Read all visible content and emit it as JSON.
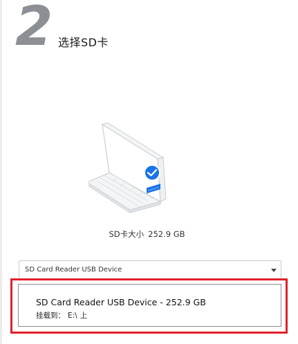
{
  "step": {
    "number": "2",
    "title": "选择SD卡"
  },
  "illustration": {
    "icon": "laptop-with-sd-card-icon",
    "accent_color": "#1a73e8"
  },
  "card_info": {
    "label": "SD卡大小",
    "value": "252.9 GB"
  },
  "device_select": {
    "selected_value": "SD Card Reader USB Device"
  },
  "device_option": {
    "name": "SD Card Reader USB Device - 252.9 GB",
    "mount_label": "挂载到：",
    "mount_point": "E:\\",
    "mount_suffix": "上"
  },
  "colors": {
    "highlight_border": "#e0202a",
    "step_number": "#8c9095"
  }
}
